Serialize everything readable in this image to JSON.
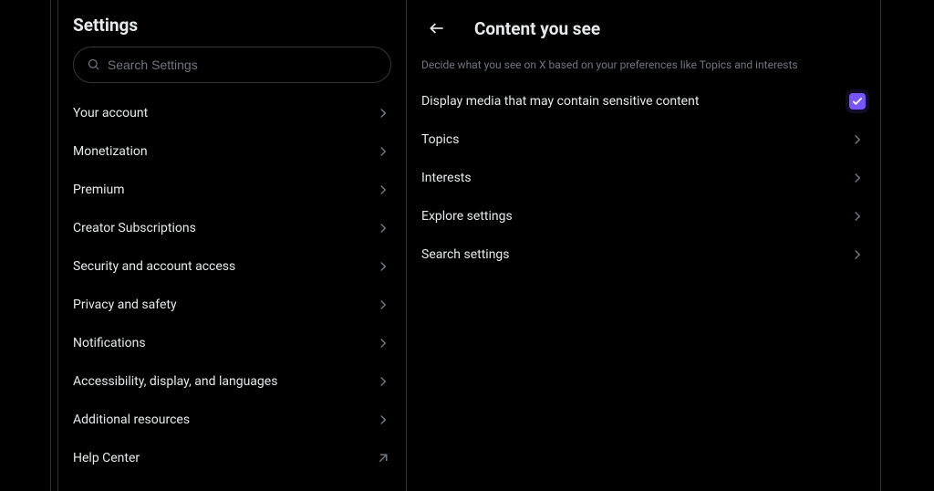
{
  "settings": {
    "title": "Settings",
    "search_placeholder": "Search Settings",
    "items": [
      {
        "label": "Your account",
        "kind": "nav"
      },
      {
        "label": "Monetization",
        "kind": "nav"
      },
      {
        "label": "Premium",
        "kind": "nav"
      },
      {
        "label": "Creator Subscriptions",
        "kind": "nav"
      },
      {
        "label": "Security and account access",
        "kind": "nav"
      },
      {
        "label": "Privacy and safety",
        "kind": "nav"
      },
      {
        "label": "Notifications",
        "kind": "nav"
      },
      {
        "label": "Accessibility, display, and languages",
        "kind": "nav"
      },
      {
        "label": "Additional resources",
        "kind": "nav"
      },
      {
        "label": "Help Center",
        "kind": "ext"
      }
    ]
  },
  "detail": {
    "title": "Content you see",
    "subtitle": "Decide what you see on X based on your preferences like Topics and interests",
    "rows": [
      {
        "label": "Display media that may contain sensitive content",
        "kind": "checkbox",
        "checked": true
      },
      {
        "label": "Topics",
        "kind": "nav"
      },
      {
        "label": "Interests",
        "kind": "nav"
      },
      {
        "label": "Explore settings",
        "kind": "nav"
      },
      {
        "label": "Search settings",
        "kind": "nav"
      }
    ]
  },
  "colors": {
    "accent": "#7856ff",
    "text": "#e7e9ea",
    "muted": "#71767b",
    "border": "#2f3336"
  }
}
